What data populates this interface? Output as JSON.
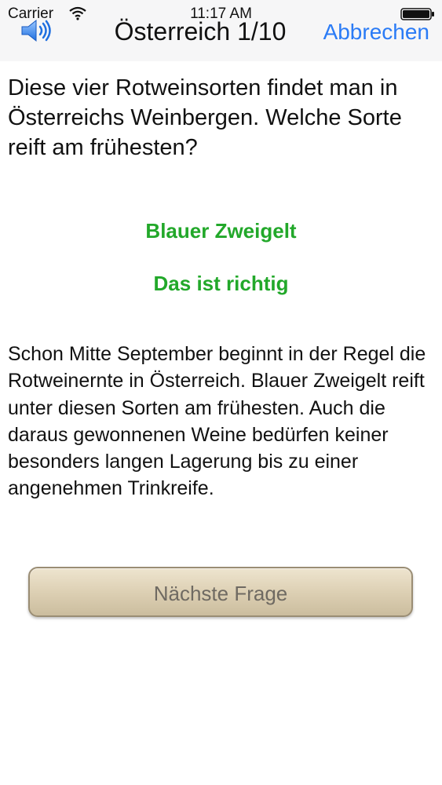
{
  "status_bar": {
    "carrier": "Carrier",
    "time": "11:17 AM",
    "wifi_icon": "wifi-icon",
    "battery_icon": "battery-icon"
  },
  "nav": {
    "audio_icon": "speaker-icon",
    "title": "Österreich 1/10",
    "cancel_label": "Abbrechen"
  },
  "quiz": {
    "question": "Diese vier Rotweinsorten findet man in Österreichs Weinbergen. Welche Sorte reift am frühesten?",
    "answer": "Blauer Zweigelt",
    "verdict": "Das ist richtig",
    "explanation": "Schon Mitte September beginnt in der Regel die Rotweinernte in Österreich. Blauer Zweigelt reift unter diesen Sorten am frühesten. Auch die daraus gewonnenen Weine bedürfen keiner besonders langen Lagerung bis zu einer angenehmen Trinkreife.",
    "next_label": "Nächste Frage"
  },
  "colors": {
    "accent": "#2a7bf6",
    "correct": "#22a82a",
    "button_fill": "#ddd0b4"
  }
}
